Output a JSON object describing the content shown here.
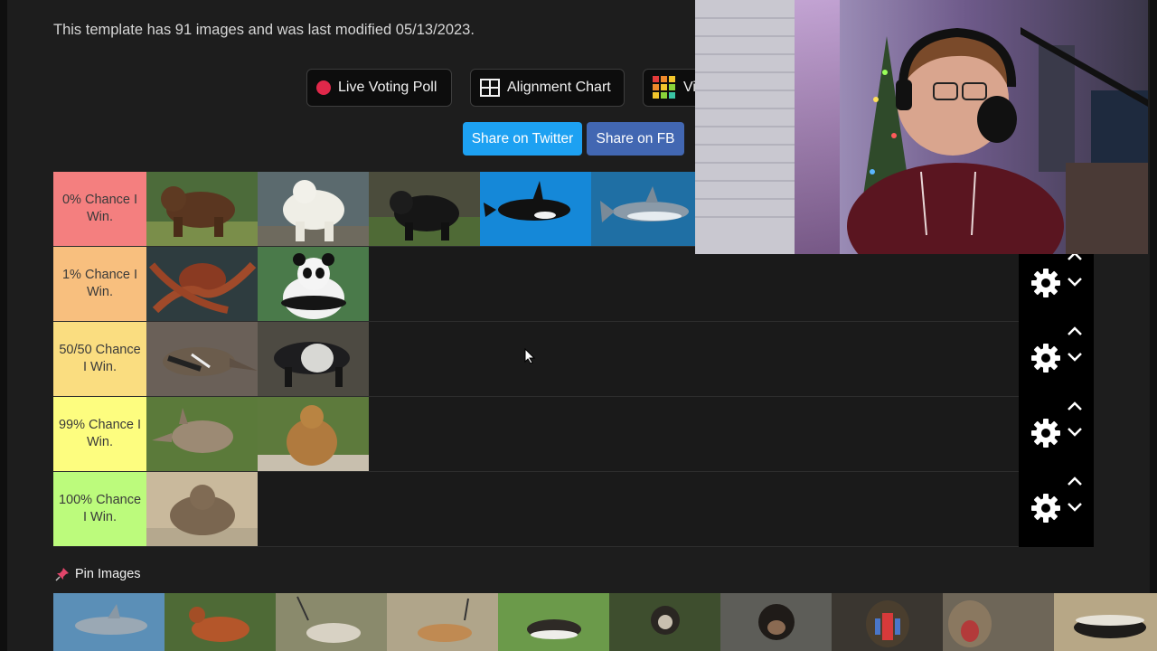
{
  "info_text": "This template has 91 images and was last modified 05/13/2023.",
  "toolbar": {
    "live_poll_label": "Live Voting Poll",
    "alignment_label": "Alignment Chart",
    "third_label": "Vi"
  },
  "share": {
    "twitter_label": "Share on Twitter",
    "facebook_label": "Share on FB"
  },
  "colors": {
    "tier0": "#f47f7f",
    "tier1": "#f8bf7e",
    "tier2": "#fadd80",
    "tier3": "#fdfd7f",
    "tier4": "#bcfb7c",
    "twitter": "#1da1f2",
    "facebook": "#4267b2"
  },
  "tiers": [
    {
      "label": "0% Chance I Win.",
      "items": [
        "brown-bear",
        "polar-bear",
        "black-bear",
        "orca",
        "great-white-shark"
      ]
    },
    {
      "label": "1% Chance I Win.",
      "items": [
        "octopus",
        "giant-panda"
      ]
    },
    {
      "label": "50/50 Chance I Win.",
      "items": [
        "giant-anteater",
        "tapir"
      ]
    },
    {
      "label": "99% Chance I Win.",
      "items": [
        "aardvark",
        "prairie-dog"
      ]
    },
    {
      "label": "100% Chance I Win.",
      "items": [
        "groundhog"
      ]
    }
  ],
  "pin_title": "Pin Images",
  "pool_items": [
    "dolphin",
    "bongo-antelope",
    "oryx",
    "gazelle",
    "blackbuck",
    "gibbon",
    "chimpanzee",
    "mandrill",
    "baboon",
    "honey-badger"
  ]
}
